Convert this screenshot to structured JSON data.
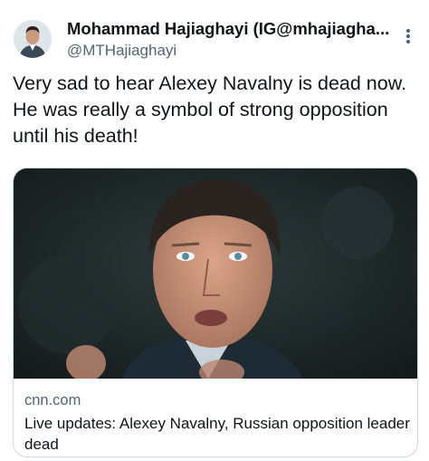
{
  "author": {
    "display_name": "Mohammad Hajiaghayi (IG@mhajiagha...",
    "handle": "@MTHajiaghayi",
    "avatar_icon": "profile-photo"
  },
  "tweet": {
    "text": "Very sad to hear Alexey Navalny is dead now. He was really a symbol of strong opposition until his death!"
  },
  "link_card": {
    "domain": "cnn.com",
    "title": "Live updates: Alexey Navalny, Russian opposition leader dead",
    "image_icon": "news-photo"
  },
  "menu": {
    "more_icon": "more-vertical-icon"
  },
  "colors": {
    "text_primary": "#0f1419",
    "text_secondary": "#536471",
    "card_border": "#cfd9de"
  }
}
